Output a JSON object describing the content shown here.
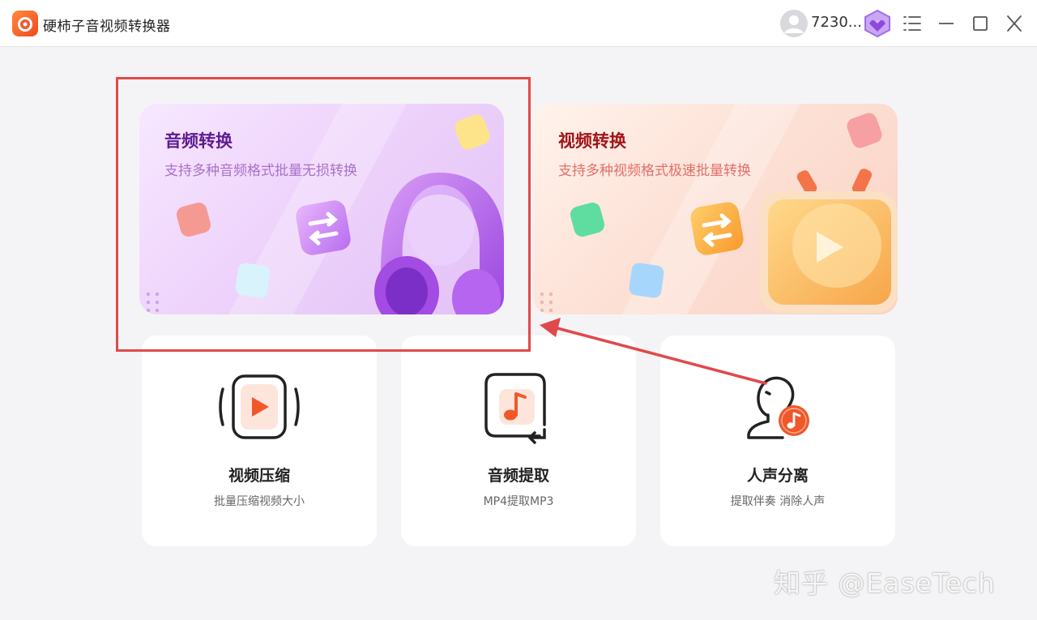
{
  "window": {
    "title": "硬柿子音视频转换器",
    "username": "7230...",
    "controls": [
      "menu-icon",
      "minimize-icon",
      "maximize-icon",
      "close-icon"
    ]
  },
  "feature_cards": [
    {
      "title": "音频转换",
      "subtitle": "支持多种音频格式批量无损转换"
    },
    {
      "title": "视频转换",
      "subtitle": "支持多种视频格式极速批量转换"
    }
  ],
  "tools": [
    {
      "title": "视频压缩",
      "subtitle": "批量压缩视频大小",
      "icon": "video-compress-icon"
    },
    {
      "title": "音频提取",
      "subtitle": "MP4提取MP3",
      "icon": "audio-extract-icon"
    },
    {
      "title": "人声分离",
      "subtitle": "提取伴奏 消除人声",
      "icon": "vocal-separate-icon"
    }
  ],
  "watermark": "知乎 @EaseTech",
  "colors": {
    "brand_orange": "#f0582a",
    "highlight_red": "#e0494b",
    "audio_title": "#5e1b93",
    "video_title": "#a0151a"
  }
}
